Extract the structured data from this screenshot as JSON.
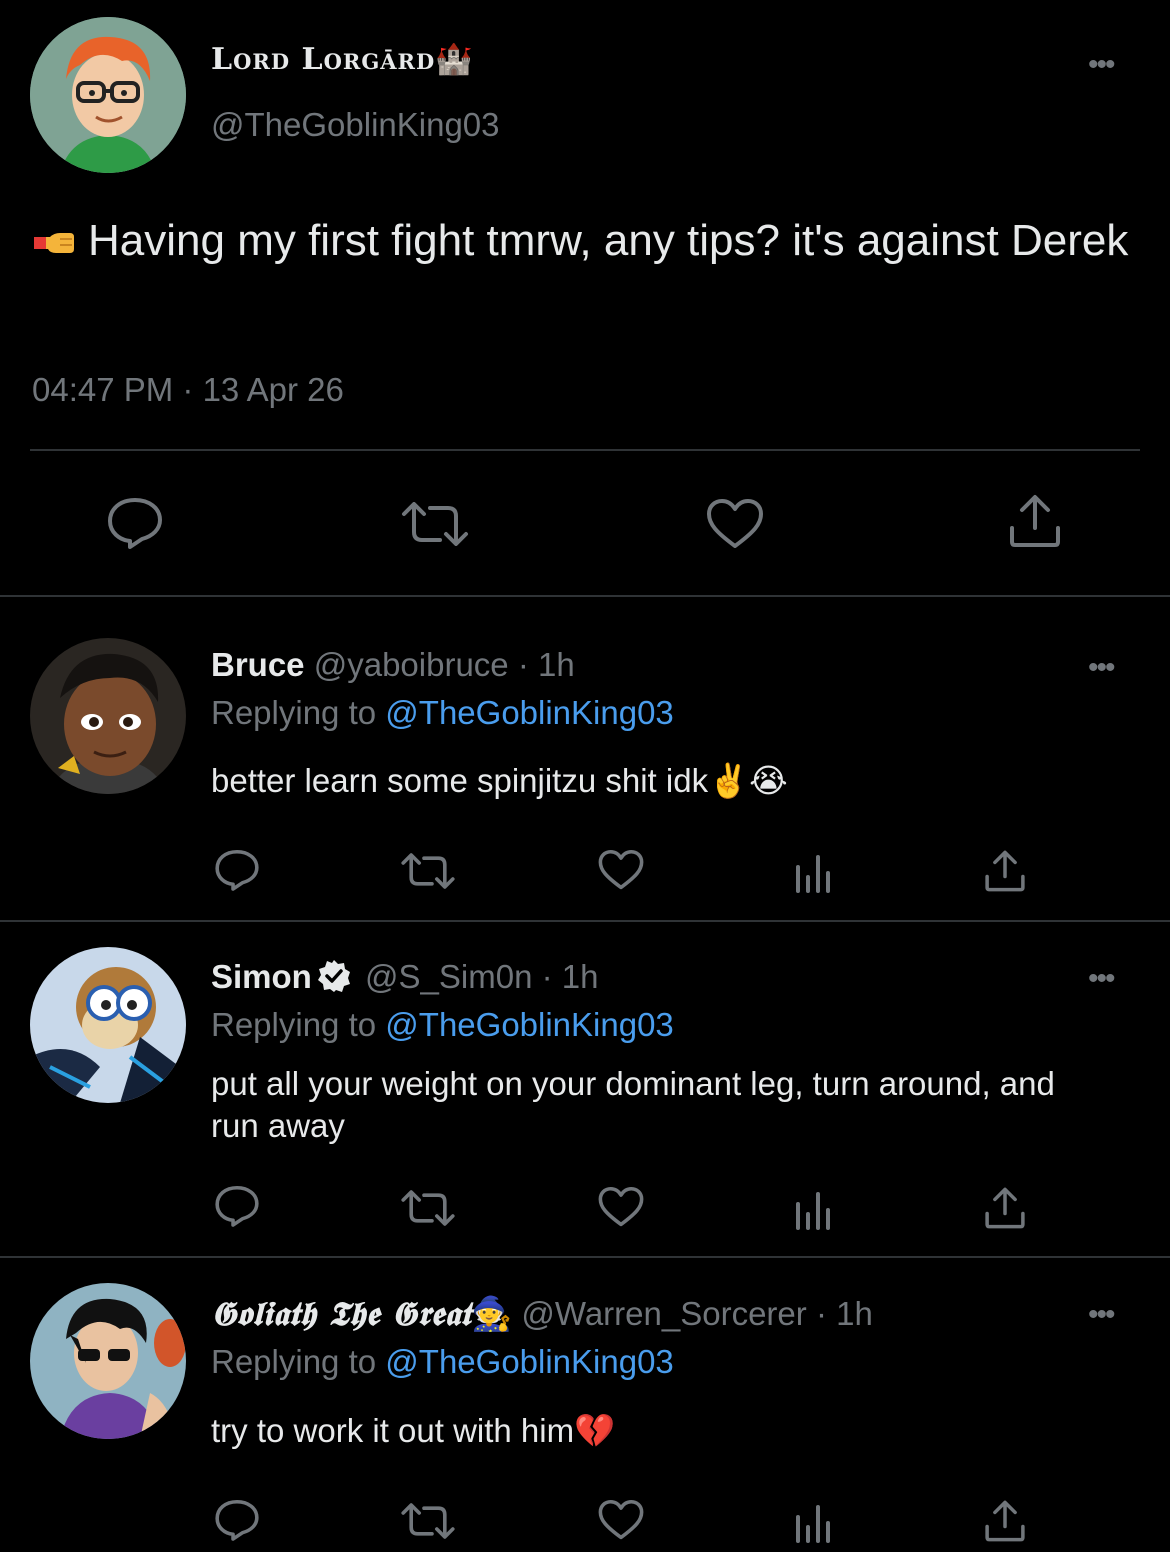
{
  "main_tweet": {
    "display_name": "Lord Lorgārd🏰",
    "handle": "@TheGoblinKing03",
    "text": "Having my first fight tmrw, any tips? it's against Derek",
    "timestamp": "04:47 PM · 13 Apr 26",
    "actions": [
      "reply-icon",
      "retweet-icon",
      "like-icon",
      "share-icon"
    ]
  },
  "replies": [
    {
      "display_name": "Bruce",
      "handle": "@yaboibruce",
      "time": "· 1h",
      "replying_label": "Replying to",
      "replying_to": "@TheGoblinKing03",
      "text": "better learn some spinjitzu shit idk",
      "emojis": "✌️😭",
      "verified": false
    },
    {
      "display_name": "Simon",
      "handle": "@S_Sim0n",
      "time": "· 1h",
      "replying_label": "Replying to",
      "replying_to": "@TheGoblinKing03",
      "text": "put all your weight on your dominant leg, turn around, and run away",
      "verified": true
    },
    {
      "display_name": "𝕲𝖔𝖑𝖎𝖆𝖙𝖍 𝕿𝖍𝖊 𝕲𝖗𝖊𝖆𝖙",
      "name_emoji": "🧙",
      "handle": "@Warren_Sorcerer",
      "time": "· 1h",
      "replying_label": "Replying to",
      "replying_to": "@TheGoblinKing03",
      "text": "try to work it out with him",
      "emojis": "💔",
      "verified": false
    }
  ],
  "colors": {
    "background": "#000000",
    "primary_text": "#e7e9ea",
    "secondary_text": "#71767b",
    "mention": "#4a9ded",
    "separator": "#2f3336"
  }
}
